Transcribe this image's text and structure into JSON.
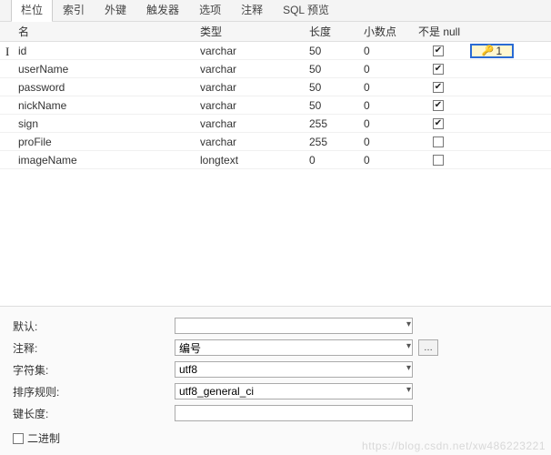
{
  "tabs": [
    {
      "label": "栏位",
      "active": true
    },
    {
      "label": "索引",
      "active": false
    },
    {
      "label": "外键",
      "active": false
    },
    {
      "label": "触发器",
      "active": false
    },
    {
      "label": "选项",
      "active": false
    },
    {
      "label": "注释",
      "active": false
    },
    {
      "label": "SQL 预览",
      "active": false
    }
  ],
  "columns": {
    "name": "名",
    "type": "类型",
    "length": "长度",
    "decimals": "小数点",
    "not_null": "不是 null"
  },
  "fields": [
    {
      "name": "id",
      "type": "varchar",
      "length": 50,
      "decimals": 0,
      "not_null": true,
      "is_key": true,
      "key_index": 1,
      "editing": true
    },
    {
      "name": "userName",
      "type": "varchar",
      "length": 50,
      "decimals": 0,
      "not_null": true,
      "is_key": false,
      "editing": false
    },
    {
      "name": "password",
      "type": "varchar",
      "length": 50,
      "decimals": 0,
      "not_null": true,
      "is_key": false,
      "editing": false
    },
    {
      "name": "nickName",
      "type": "varchar",
      "length": 50,
      "decimals": 0,
      "not_null": true,
      "is_key": false,
      "editing": false
    },
    {
      "name": "sign",
      "type": "varchar",
      "length": 255,
      "decimals": 0,
      "not_null": true,
      "is_key": false,
      "editing": false
    },
    {
      "name": "proFile",
      "type": "varchar",
      "length": 255,
      "decimals": 0,
      "not_null": false,
      "is_key": false,
      "editing": false
    },
    {
      "name": "imageName",
      "type": "longtext",
      "length": 0,
      "decimals": 0,
      "not_null": false,
      "is_key": false,
      "editing": false
    }
  ],
  "panel": {
    "default_label": "默认:",
    "default_value": "",
    "comment_label": "注释:",
    "comment_value": "编号",
    "charset_label": "字符集:",
    "charset_value": "utf8",
    "collation_label": "排序规则:",
    "collation_value": "utf8_general_ci",
    "keylength_label": "键长度:",
    "keylength_value": "",
    "binary_label": "二进制",
    "binary_checked": false
  },
  "watermark": "https://blog.csdn.net/xw486223221"
}
